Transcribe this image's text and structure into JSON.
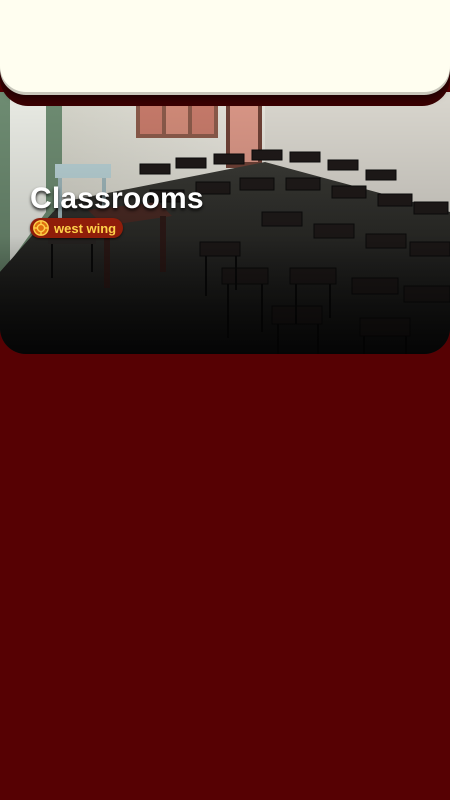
{
  "card": {
    "title": "Classrooms",
    "location": "west wing",
    "photo_icon": "classroom-photo",
    "location_icon": "crosshair-target-icon"
  },
  "colors": {
    "background": "#560103",
    "header_panel": "#fffef0",
    "title_text": "#ffffff",
    "badge_background": "#8f1d0a",
    "badge_text": "#ffd24a"
  }
}
